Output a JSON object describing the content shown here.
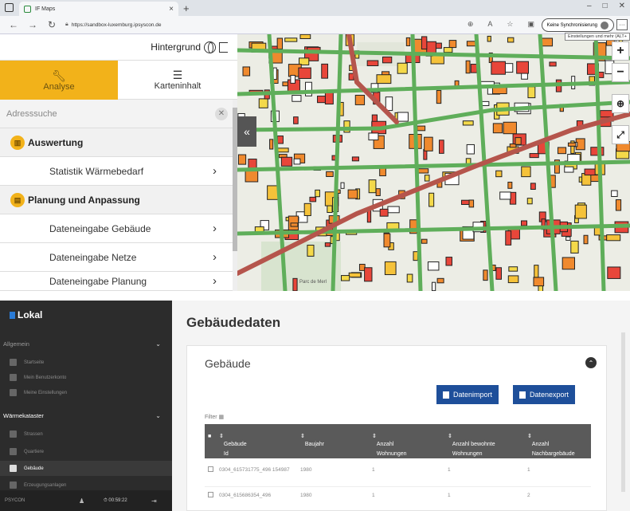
{
  "browser": {
    "tab_title": "IF Maps",
    "tab_close": "×",
    "new_tab": "+",
    "url": "https://sandbox-luxemburg.ipsyscon.de",
    "sync_label": "Keine Synchronisierung",
    "tooltip": "Einstellungen und mehr (ALT+",
    "more": "···",
    "win_min": "–",
    "win_max": "□",
    "win_close": "✕"
  },
  "panel": {
    "hintergrund": "Hintergrund",
    "tab_analyse": "Analyse",
    "tab_karteninhalt": "Karteninhalt",
    "search_placeholder": "Adresssuche",
    "section1": "Auswertung",
    "item1": "Statistik Wärmebedarf",
    "section2": "Planung und Anpassung",
    "item2": "Dateneingabe Gebäude",
    "item3": "Dateneingabe Netze",
    "item4": "Dateneingabe Planung"
  },
  "map": {
    "zoom_in": "+",
    "zoom_out": "−",
    "collapse": "«",
    "place_label": "Parc de Merl"
  },
  "admin": {
    "brand": "Lokal",
    "group1": "Allgemein",
    "g1_items": [
      "Startseite",
      "Mein Benutzerkonto",
      "Meine Einstellungen"
    ],
    "group2": "Wärmekataster",
    "g2_items": [
      "Strassen",
      "Quartiere",
      "Gebäude",
      "Erzeugungsanlagen"
    ],
    "footer_left": "PSYCON",
    "footer_time": "00:59:22",
    "page_title": "Gebäudedaten",
    "card_title": "Gebäude",
    "btn_import": "Datenimport",
    "btn_export": "Datenexport",
    "filter": "Filter",
    "columns": [
      "Gebäude Id",
      "Baujahr",
      "Anzahl Wohnungen",
      "Anzahl bewohnte Wohnungen",
      "Anzahl Nachbargebäude"
    ],
    "rows": [
      {
        "id": "0304_615731775_496 154987",
        "baujahr": "1980",
        "wohnungen": "1",
        "bewohnt": "1",
        "nachbar": "1"
      },
      {
        "id": "0304_615686354_496",
        "baujahr": "1980",
        "wohnungen": "1",
        "bewohnt": "1",
        "nachbar": "2"
      }
    ]
  }
}
